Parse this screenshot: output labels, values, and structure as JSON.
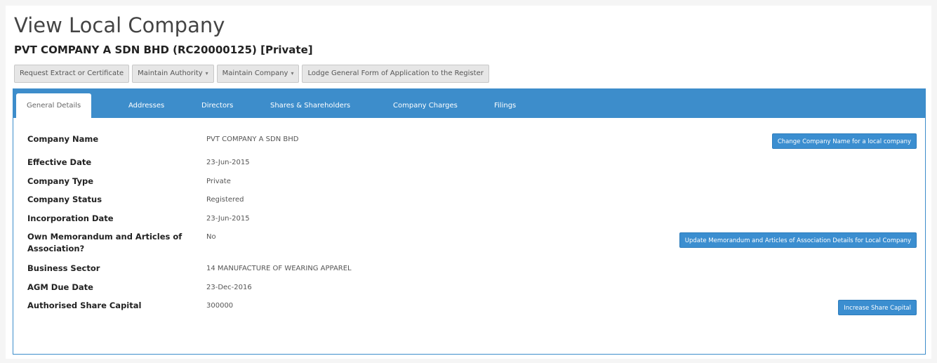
{
  "page": {
    "title": "View Local Company",
    "subtitle": "PVT COMPANY A SDN BHD (RC20000125) [Private]"
  },
  "actions": [
    {
      "label": "Request Extract or Certificate",
      "dropdown": false
    },
    {
      "label": "Maintain Authority",
      "dropdown": true
    },
    {
      "label": "Maintain Company",
      "dropdown": true
    },
    {
      "label": "Lodge General Form of Application to the Register",
      "dropdown": false
    }
  ],
  "tabs": [
    {
      "label": "General Details",
      "active": true
    },
    {
      "label": "Addresses",
      "active": false
    },
    {
      "label": "Directors",
      "active": false
    },
    {
      "label": "Shares & Shareholders",
      "active": false
    },
    {
      "label": "Company Charges",
      "active": false
    },
    {
      "label": "Filings",
      "active": false
    }
  ],
  "details": {
    "company_name": {
      "label": "Company Name",
      "value": "PVT COMPANY A SDN BHD"
    },
    "effective_date": {
      "label": "Effective Date",
      "value": "23-Jun-2015"
    },
    "company_type": {
      "label": "Company Type",
      "value": "Private"
    },
    "company_status": {
      "label": "Company Status",
      "value": "Registered"
    },
    "incorporation_date": {
      "label": "Incorporation Date",
      "value": "23-Jun-2015"
    },
    "own_memorandum": {
      "label": "Own Memorandum and Articles of Association?",
      "value": "No"
    },
    "business_sector": {
      "label": "Business Sector",
      "value": "14 MANUFACTURE OF WEARING APPAREL"
    },
    "agm_due_date": {
      "label": "AGM Due Date",
      "value": "23-Dec-2016"
    },
    "authorised_share_capital": {
      "label": "Authorised Share Capital",
      "value": "300000"
    }
  },
  "buttons": {
    "change_name": "Change Company Name for a local company",
    "update_memorandum": "Update Memorandum and Articles of Association Details for Local Company",
    "increase_capital": "Increase Share Capital"
  },
  "colors": {
    "tab_bar": "#3d8dcb",
    "primary_button": "#3b8ed0"
  }
}
